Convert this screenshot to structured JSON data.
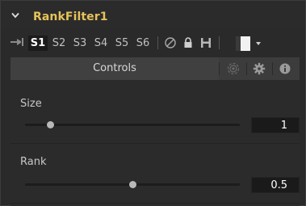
{
  "node": {
    "title": "RankFilter1"
  },
  "toolbar": {
    "views": [
      {
        "label": "S1",
        "active": true
      },
      {
        "label": "S2",
        "active": false
      },
      {
        "label": "S3",
        "active": false
      },
      {
        "label": "S4",
        "active": false
      },
      {
        "label": "S5",
        "active": false
      },
      {
        "label": "S6",
        "active": false
      }
    ],
    "icons": [
      "pin-icon",
      "disable-icon",
      "lock-icon",
      "save-icon",
      "color-swatch-icon",
      "dropdown-arrow-icon"
    ]
  },
  "tabs": {
    "controls_label": "Controls",
    "icons": [
      "radio-waves-icon",
      "gear-icon",
      "info-icon"
    ]
  },
  "controls": {
    "size": {
      "label": "Size",
      "value": "1",
      "slider_fraction": 0.12
    },
    "rank": {
      "label": "Rank",
      "value": "0.5",
      "slider_fraction": 0.5
    }
  },
  "colors": {
    "title": "#e6c25a",
    "background": "#2a2a2a",
    "field": "#1a1a1a"
  }
}
